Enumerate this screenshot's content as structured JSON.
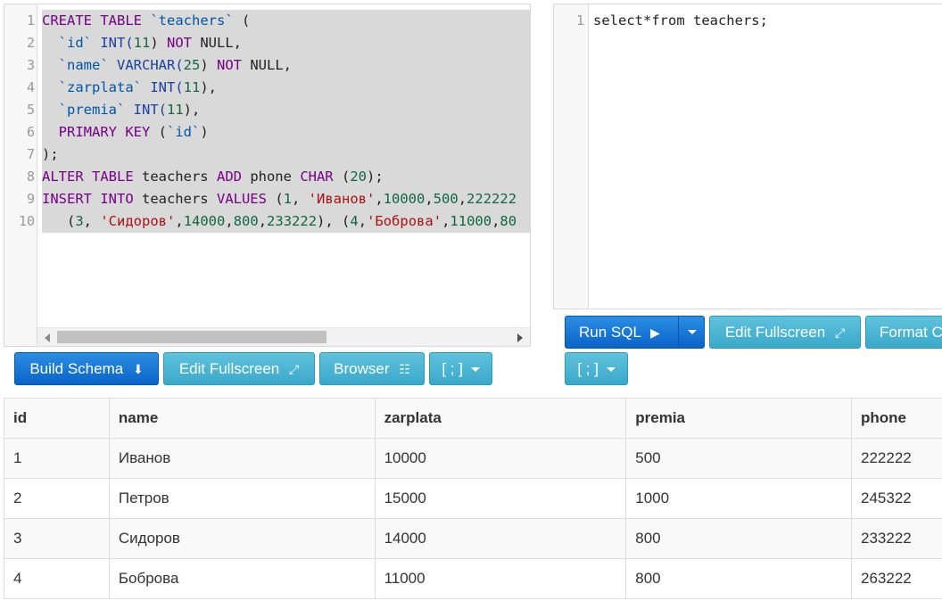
{
  "schema_editor": {
    "line_numbers": [
      "1",
      "2",
      "3",
      "4",
      "5",
      "6",
      "7",
      "8",
      "9",
      "10"
    ],
    "lines": [
      [
        {
          "t": "CREATE TABLE ",
          "c": "kw"
        },
        {
          "t": "`teachers`",
          "c": "bt"
        },
        {
          "t": " (",
          "c": "plain"
        }
      ],
      [
        {
          "t": "  ",
          "c": "plain"
        },
        {
          "t": "`id`",
          "c": "bt"
        },
        {
          "t": " INT(",
          "c": "kw2"
        },
        {
          "t": "11",
          "c": "num"
        },
        {
          "t": ") ",
          "c": "plain"
        },
        {
          "t": "NOT",
          "c": "kw"
        },
        {
          "t": " NULL,",
          "c": "plain"
        }
      ],
      [
        {
          "t": "  ",
          "c": "plain"
        },
        {
          "t": "`name`",
          "c": "bt"
        },
        {
          "t": " VARCHAR(",
          "c": "kw2"
        },
        {
          "t": "25",
          "c": "num"
        },
        {
          "t": ") ",
          "c": "plain"
        },
        {
          "t": "NOT",
          "c": "kw"
        },
        {
          "t": " NULL,",
          "c": "plain"
        }
      ],
      [
        {
          "t": "  ",
          "c": "plain"
        },
        {
          "t": "`zarplata`",
          "c": "bt"
        },
        {
          "t": " INT(",
          "c": "kw2"
        },
        {
          "t": "11",
          "c": "num"
        },
        {
          "t": "),",
          "c": "plain"
        }
      ],
      [
        {
          "t": "  ",
          "c": "plain"
        },
        {
          "t": "`premia`",
          "c": "bt"
        },
        {
          "t": " INT(",
          "c": "kw2"
        },
        {
          "t": "11",
          "c": "num"
        },
        {
          "t": "),",
          "c": "plain"
        }
      ],
      [
        {
          "t": "  PRIMARY KEY ",
          "c": "kw"
        },
        {
          "t": "(",
          "c": "plain"
        },
        {
          "t": "`id`",
          "c": "bt"
        },
        {
          "t": ")",
          "c": "plain"
        }
      ],
      [
        {
          "t": ");",
          "c": "plain"
        }
      ],
      [
        {
          "t": "ALTER TABLE ",
          "c": "kw"
        },
        {
          "t": "teachers ",
          "c": "plain"
        },
        {
          "t": "ADD",
          "c": "kw"
        },
        {
          "t": " phone ",
          "c": "plain"
        },
        {
          "t": "CHAR",
          "c": "kw"
        },
        {
          "t": " (",
          "c": "plain"
        },
        {
          "t": "20",
          "c": "num"
        },
        {
          "t": ");",
          "c": "plain"
        }
      ],
      [
        {
          "t": "INSERT INTO ",
          "c": "kw"
        },
        {
          "t": "teachers ",
          "c": "plain"
        },
        {
          "t": "VALUES",
          "c": "kw"
        },
        {
          "t": " (",
          "c": "plain"
        },
        {
          "t": "1",
          "c": "num"
        },
        {
          "t": ", ",
          "c": "plain"
        },
        {
          "t": "'Иванов'",
          "c": "str"
        },
        {
          "t": ",",
          "c": "plain"
        },
        {
          "t": "10000",
          "c": "num"
        },
        {
          "t": ",",
          "c": "plain"
        },
        {
          "t": "500",
          "c": "num"
        },
        {
          "t": ",",
          "c": "plain"
        },
        {
          "t": "222222",
          "c": "num"
        }
      ],
      [
        {
          "t": "   (",
          "c": "plain"
        },
        {
          "t": "3",
          "c": "num"
        },
        {
          "t": ", ",
          "c": "plain"
        },
        {
          "t": "'Сидоров'",
          "c": "str"
        },
        {
          "t": ",",
          "c": "plain"
        },
        {
          "t": "14000",
          "c": "num"
        },
        {
          "t": ",",
          "c": "plain"
        },
        {
          "t": "800",
          "c": "num"
        },
        {
          "t": ",",
          "c": "plain"
        },
        {
          "t": "233222",
          "c": "num"
        },
        {
          "t": "), (",
          "c": "plain"
        },
        {
          "t": "4",
          "c": "num"
        },
        {
          "t": ",",
          "c": "plain"
        },
        {
          "t": "'Боброва'",
          "c": "str"
        },
        {
          "t": ",",
          "c": "plain"
        },
        {
          "t": "11000",
          "c": "num"
        },
        {
          "t": ",",
          "c": "plain"
        },
        {
          "t": "80",
          "c": "num"
        }
      ]
    ]
  },
  "query_editor": {
    "line_numbers": [
      "1"
    ],
    "lines": [
      [
        {
          "t": "select*from teachers;",
          "c": "plain"
        }
      ]
    ]
  },
  "schema_toolbar": {
    "build_schema": "Build Schema",
    "edit_fullscreen": "Edit Fullscreen",
    "browser": "Browser",
    "delimiter": "[ ; ]"
  },
  "query_toolbar": {
    "run_sql": "Run SQL",
    "edit_fullscreen": "Edit Fullscreen",
    "format": "Format C",
    "delimiter": "[ ; ]"
  },
  "results": {
    "columns": [
      "id",
      "name",
      "zarplata",
      "premia",
      "phone"
    ],
    "rows": [
      [
        "1",
        "Иванов",
        "10000",
        "500",
        "222222"
      ],
      [
        "2",
        "Петров",
        "15000",
        "1000",
        "245322"
      ],
      [
        "3",
        "Сидоров",
        "14000",
        "800",
        "233222"
      ],
      [
        "4",
        "Боброва",
        "11000",
        "800",
        "263222"
      ]
    ]
  },
  "colors": {
    "primary": "#0a63c9",
    "info": "#3aa8c9",
    "keyword": "#770088",
    "string": "#aa1111",
    "number": "#116644"
  }
}
